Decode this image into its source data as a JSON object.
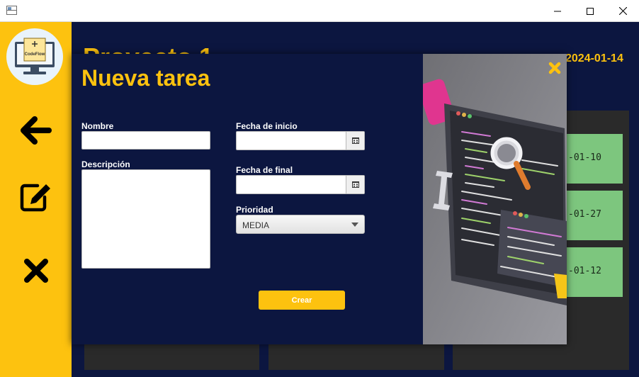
{
  "window": {
    "icons": {
      "app": "app-window-icon",
      "minimize": "minimize-icon",
      "maximize": "maximize-icon",
      "close": "close-icon"
    }
  },
  "sidebar": {
    "logo_text": "CodeFlow",
    "buttons": [
      {
        "name": "back",
        "icon": "arrow-left-icon"
      },
      {
        "name": "edit",
        "icon": "edit-icon"
      },
      {
        "name": "delete",
        "icon": "x-icon"
      }
    ]
  },
  "background": {
    "project_title": "Proyecto 1",
    "date": "2024-01-14",
    "cards": [
      "-01-10",
      "-01-27",
      "-01-12"
    ]
  },
  "modal": {
    "title": "Nueva tarea",
    "fields": {
      "nombre": {
        "label": "Nombre",
        "value": ""
      },
      "descripcion": {
        "label": "Descripción",
        "value": ""
      },
      "fecha_inicio": {
        "label": "Fecha de inicio",
        "value": ""
      },
      "fecha_final": {
        "label": "Fecha de final",
        "value": ""
      },
      "prioridad": {
        "label": "Prioridad",
        "value": "MEDIA"
      }
    },
    "submit_label": "Crear",
    "close_icon": "close-x-icon",
    "image": "code-illustration"
  },
  "colors": {
    "primary": "#fdc20f",
    "background": "#0c1640",
    "card": "#7dc67e",
    "column": "#2a2a2a"
  }
}
